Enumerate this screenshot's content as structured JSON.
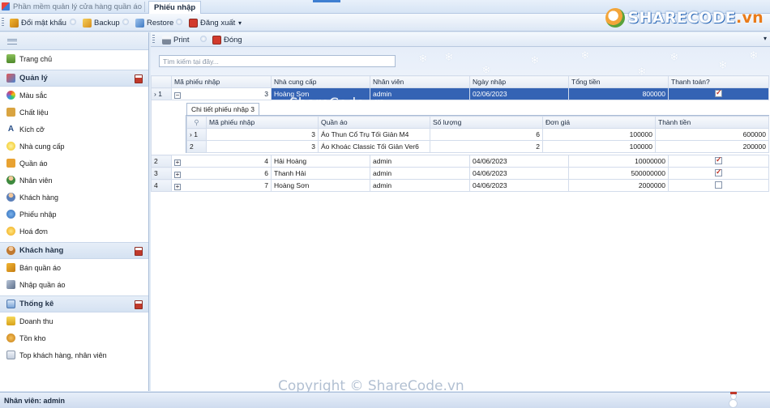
{
  "window": {
    "app_title": "Phần mềm quản lý cửa hàng quần áo",
    "active_tab": "Phiếu nhập"
  },
  "toolbar": {
    "change_password": "Đổi mật khẩu",
    "backup": "Backup",
    "restore": "Restore",
    "logout": "Đăng xuất"
  },
  "logo": {
    "brand": "SHARECODE",
    "suffix": ".vn"
  },
  "sidebar": {
    "home": "Trang chủ",
    "groups": [
      {
        "label": "Quản lý",
        "items": [
          "Màu sắc",
          "Chất liệu",
          "Kích cỡ",
          "Nhà cung cấp",
          "Quần áo",
          "Nhân viên",
          "Khách hàng",
          "Phiếu nhập",
          "Hoá đơn"
        ]
      },
      {
        "label": "Khách hàng",
        "items": [
          "Bán quần áo",
          "Nhập quần áo"
        ]
      },
      {
        "label": "Thống kê",
        "items": [
          "Doanh thu",
          "Tồn kho",
          "Top khách hàng, nhân viên"
        ]
      }
    ]
  },
  "main": {
    "print": "Print",
    "close": "Đóng",
    "search_placeholder": "Tìm kiếm tại đây...",
    "columns": [
      "Mã phiếu nhập",
      "Nhà cung cấp",
      "Nhân viên",
      "Ngày nhập",
      "Tổng tiền",
      "Thanh toán?"
    ],
    "rows": [
      {
        "idx": "1",
        "id": "3",
        "supplier": "Hoàng Sơn",
        "staff": "admin",
        "date": "02/06/2023",
        "total": "800000",
        "paid": true
      },
      {
        "idx": "2",
        "id": "4",
        "supplier": "Hải Hoàng",
        "staff": "admin",
        "date": "04/06/2023",
        "total": "10000000",
        "paid": true
      },
      {
        "idx": "3",
        "id": "6",
        "supplier": "Thanh Hải",
        "staff": "admin",
        "date": "04/06/2023",
        "total": "500000000",
        "paid": true
      },
      {
        "idx": "4",
        "id": "7",
        "supplier": "Hoàng Sơn",
        "staff": "admin",
        "date": "04/06/2023",
        "total": "2000000",
        "paid": false
      }
    ],
    "detail": {
      "tab": "Chi tiết phiếu nhập 3",
      "columns": [
        "Mã phiếu nhập",
        "Quần áo",
        "Số lượng",
        "Đơn giá",
        "Thành tiền"
      ],
      "rows": [
        {
          "idx": "1",
          "id": "3",
          "item": "Áo Thun Cổ Trụ Tối Giản M4",
          "qty": "6",
          "price": "100000",
          "amount": "600000"
        },
        {
          "idx": "2",
          "id": "3",
          "item": "Áo Khoác Classic Tối Giản Ver6",
          "qty": "2",
          "price": "100000",
          "amount": "200000"
        }
      ]
    }
  },
  "watermarks": {
    "center": "ShareCode.vn",
    "bottom": "Copyright © ShareCode.vn"
  },
  "status": {
    "user": "Nhân viên: admin"
  },
  "colors": {
    "selection": "#3463b4",
    "accent": "#3f7fd1",
    "danger": "#c0392b"
  }
}
